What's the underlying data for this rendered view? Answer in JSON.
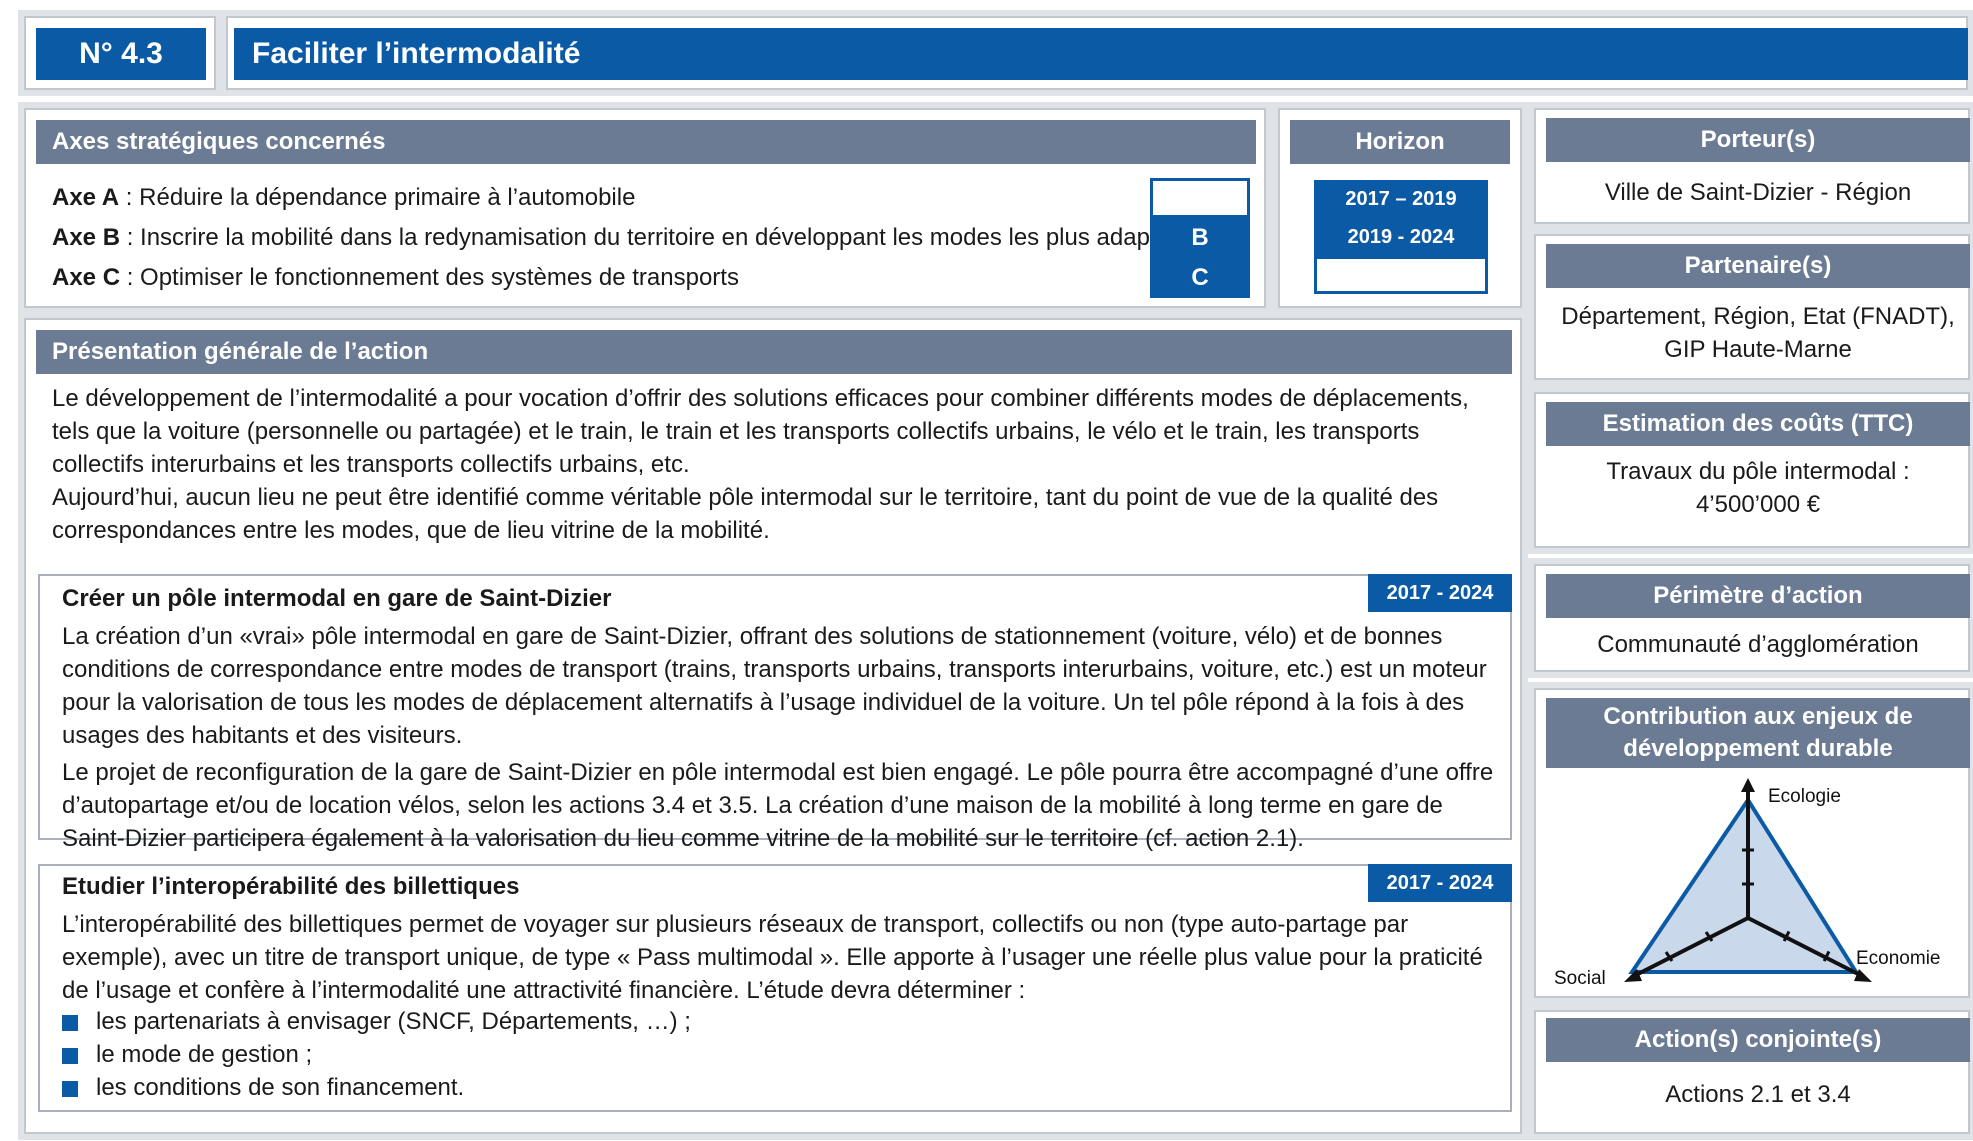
{
  "header": {
    "number": "N° 4.3",
    "title": "Faciliter l’intermodalité"
  },
  "axes": {
    "title": "Axes stratégiques concernés",
    "items": [
      {
        "label": "Axe A",
        "text": " : Réduire la dépendance primaire à l’automobile",
        "marker": ""
      },
      {
        "label": "Axe B",
        "text": " : Inscrire la mobilité dans la redynamisation du territoire en développant les modes les plus adaptés",
        "marker": "B"
      },
      {
        "label": "Axe C",
        "text": " : Optimiser le fonctionnement des systèmes de transports",
        "marker": "C"
      }
    ]
  },
  "horizon": {
    "title": "Horizon",
    "periods": [
      "2017 – 2019",
      "2019 - 2024",
      ""
    ]
  },
  "presentation": {
    "title": "Présentation générale de l’action",
    "paragraphs": [
      "Le développement de l’intermodalité a pour vocation d’offrir des solutions efficaces pour combiner différents modes de déplacements, tels que la voiture (personnelle ou partagée) et le train, le train et les transports collectifs urbains, le vélo et le train, les transports collectifs interurbains et les transports collectifs urbains, etc.",
      "Aujourd’hui, aucun lieu ne peut être identifié comme véritable pôle intermodal sur le territoire, tant du point de vue de la qualité des correspondances entre les modes, que de lieu vitrine de la mobilité."
    ]
  },
  "sub_actions": [
    {
      "title": "Créer un pôle intermodal en gare de Saint-Dizier",
      "period": "2017 - 2024",
      "paragraphs": [
        "La création d’un «vrai» pôle intermodal en gare de Saint-Dizier, offrant des solutions de stationnement (voiture, vélo) et de bonnes conditions de correspondance entre modes de transport (trains, transports urbains, transports interurbains, voiture, etc.) est un moteur pour la valorisation de tous les modes de déplacement alternatifs à l’usage individuel de la voiture. Un tel pôle répond à la fois à des usages des habitants et des visiteurs.",
        "Le projet de reconfiguration de la gare de Saint-Dizier en pôle intermodal est bien engagé. Le pôle pourra être accompagné d’une offre d’autopartage et/ou de location vélos, selon les actions 3.4 et 3.5. La création d’une maison de la mobilité à long terme en gare de Saint-Dizier participera également à la valorisation du lieu comme vitrine de la mobilité sur le territoire (cf. action 2.1)."
      ]
    },
    {
      "title": "Etudier l’interopérabilité des billettiques",
      "period": "2017 - 2024",
      "paragraphs": [
        "L’interopérabilité des billettiques permet de voyager sur plusieurs réseaux de transport, collectifs ou non (type auto-partage par exemple), avec un titre de transport unique, de type « Pass multimodal ». Elle apporte à l’usager une réelle plus value pour la praticité de l’usage et confère à l’intermodalité une attractivité financière. L’étude devra déterminer :"
      ],
      "bullets": [
        "les partenariats à envisager (SNCF, Départements, …) ;",
        "le mode de gestion ;",
        "les conditions de son financement."
      ]
    }
  ],
  "sidebar": {
    "porteur": {
      "title": "Porteur(s)",
      "value": "Ville de Saint-Dizier  - Région"
    },
    "partenaires": {
      "title": "Partenaire(s)",
      "line1": "Département, Région, Etat (FNADT),",
      "line2": "GIP Haute-Marne"
    },
    "couts": {
      "title": "Estimation des coûts (TTC)",
      "line1": "Travaux du pôle intermodal :",
      "line2": "4’500’000 €"
    },
    "perimetre": {
      "title": "Périmètre d’action",
      "value": "Communauté d’agglomération"
    },
    "contribution": {
      "title_line1": "Contribution aux enjeux de",
      "title_line2": "développement durable",
      "axes": [
        "Ecologie",
        "Economie",
        "Social"
      ]
    },
    "conjointes": {
      "title": "Action(s) conjointe(s)",
      "value": "Actions 2.1 et 3.4"
    }
  },
  "colors": {
    "accent": "#0b5aa6",
    "bar": "#6b7b93",
    "radar_fill": "#c9d8ea"
  }
}
